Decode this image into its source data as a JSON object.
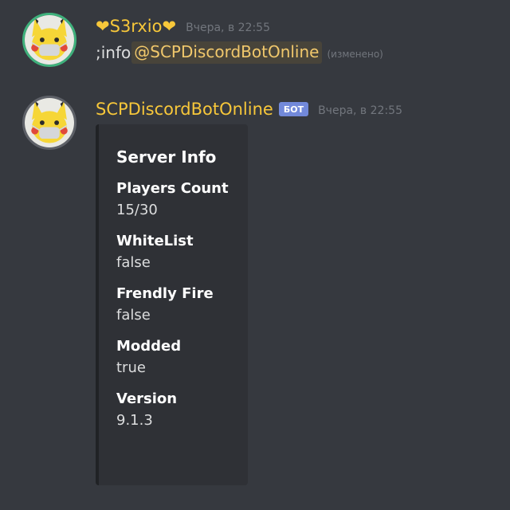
{
  "messages": [
    {
      "username": "S3rxio",
      "heart_left": "❤",
      "heart_right": "❤",
      "timestamp": "Вчера, в 22:55",
      "text": ";info",
      "mention": "@SCPDiscordBotOnline",
      "edited": "(изменено)",
      "avatar_icon": "pikachu-mask-avatar"
    },
    {
      "username": "SCPDiscordBotOnline",
      "bot_tag": "БОТ",
      "timestamp": "Вчера, в 22:55",
      "avatar_icon": "pikachu-mask-avatar",
      "embed": {
        "title": "Server Info",
        "fields": [
          {
            "name": "Players Count",
            "value": "15/30"
          },
          {
            "name": "WhiteList",
            "value": "false"
          },
          {
            "name": "Frendly Fire",
            "value": "false"
          },
          {
            "name": "Modded",
            "value": "true"
          },
          {
            "name": "Version",
            "value": "9.1.3"
          }
        ]
      }
    }
  ],
  "colors": {
    "background": "#36393f",
    "username": "#f7c73a",
    "bot_tag": "#7289da",
    "mention_bg": "#48443a",
    "embed_bg": "#2f3136"
  }
}
